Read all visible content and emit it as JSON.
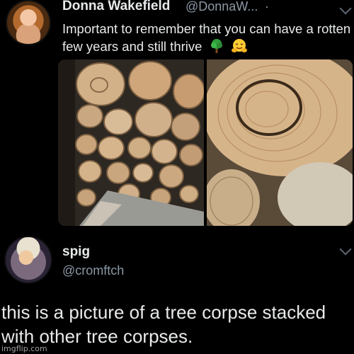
{
  "tweet1": {
    "display_name": "Donna Wakefield",
    "handle": "@DonnaW...",
    "separator": "·",
    "text": "Important to remember that you can have a rotten few years and still thrive",
    "emojis": [
      "tree-emoji",
      "hugging-face-emoji"
    ],
    "photos": [
      "stacked-logs-photo",
      "rotten-log-closeup-photo"
    ]
  },
  "tweet2": {
    "display_name": "spig",
    "handle": "@cromftch",
    "text": "this is a picture of a tree corpse stacked with other tree corpses."
  },
  "watermark": "imgflip.com",
  "colors": {
    "background": "#000000",
    "text": "#e7e9ea",
    "secondary": "#8b98a5"
  }
}
